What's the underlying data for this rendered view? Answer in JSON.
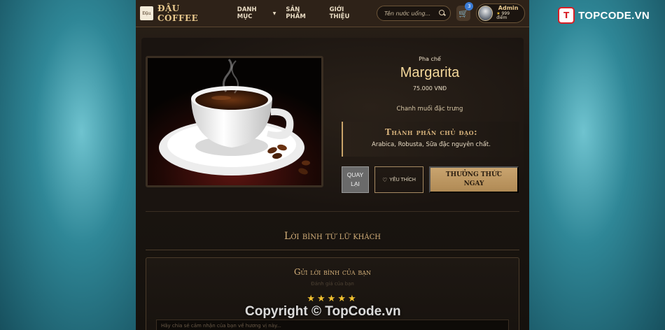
{
  "navbar": {
    "brand_logo_text": "Đậu",
    "brand_name": "ĐẬU COFFEE",
    "links": [
      {
        "label": "DANH MỤC",
        "has_dropdown": true
      },
      {
        "label": "SẢN PHẨM",
        "has_dropdown": false
      },
      {
        "label": "GIỚI THIỆU",
        "has_dropdown": false
      }
    ],
    "search_placeholder": "Tên nước uống...",
    "cart_count": "3",
    "user": {
      "name": "Admin",
      "points": "999 điểm"
    }
  },
  "product": {
    "category": "Pha chế",
    "name": "Margarita",
    "price": "75.000 VNĐ",
    "description": "Chanh muối đặc trưng",
    "ingredients_title": "Thành phần chủ đạo:",
    "ingredients": "Arabica, Robusta, Sữa đặc nguyên chất."
  },
  "actions": {
    "back_label": "QUAY LẠI",
    "favorite_label": "YÊU THÍCH",
    "order_label": "THƯỞNG THỨC NGAY"
  },
  "reviews": {
    "section_title": "Lời bình từ lữ khách",
    "form_title": "Gửi lời bình của bạn",
    "form_subtitle": "Đánh giá của bạn",
    "stars": [
      "★",
      "★",
      "★",
      "★",
      "★"
    ],
    "rating": 5,
    "comment_placeholder": "Hãy chia sẻ cảm nhận của bạn về hương vị này..."
  },
  "watermark": {
    "logo_icon": "T",
    "logo_text": "TOPCODE.VN",
    "copyright": "Copyright © TopCode.vn"
  },
  "colors": {
    "accent_gold": "#d4b07a",
    "button_gold": "#c9a46f",
    "badge_blue": "#3a7bd5",
    "star": "#f2c230"
  },
  "icons": {
    "search": "search-icon",
    "cart": "cart-icon",
    "favorite": "heart-icon"
  }
}
